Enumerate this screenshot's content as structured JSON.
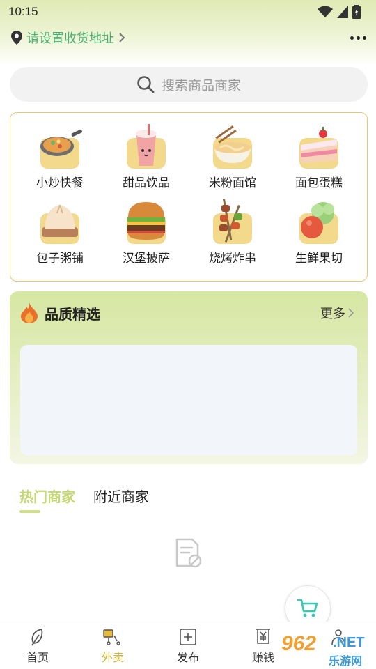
{
  "status_bar": {
    "time": "10:15",
    "icons": [
      "wifi-icon",
      "signal-icon",
      "battery-icon"
    ]
  },
  "header": {
    "location_text": "请设置收货地址",
    "location_icon": "location-pin-icon",
    "more_icon": "more-dots-icon"
  },
  "search": {
    "placeholder": "搜索商品商家",
    "icon": "search-icon"
  },
  "categories": [
    {
      "label": "小炒快餐",
      "icon": "stir-fry-pan-icon"
    },
    {
      "label": "甜品饮品",
      "icon": "milk-tea-cup-icon"
    },
    {
      "label": "米粉面馆",
      "icon": "noodle-bowl-icon"
    },
    {
      "label": "面包蛋糕",
      "icon": "cake-slice-icon"
    },
    {
      "label": "包子粥铺",
      "icon": "steamed-bun-icon"
    },
    {
      "label": "汉堡披萨",
      "icon": "burger-icon"
    },
    {
      "label": "烧烤炸串",
      "icon": "skewer-icon"
    },
    {
      "label": "生鲜果切",
      "icon": "fresh-produce-icon"
    }
  ],
  "quality": {
    "title": "品质精选",
    "icon": "flame-icon",
    "more_label": "更多"
  },
  "tabs": [
    {
      "label": "热门商家",
      "active": true
    },
    {
      "label": "附近商家",
      "active": false
    }
  ],
  "empty_state_icon": "empty-document-icon",
  "cart_icon": "shopping-cart-icon",
  "bottom_nav": [
    {
      "label": "首页",
      "icon": "home-leaf-icon",
      "active": false
    },
    {
      "label": "外卖",
      "icon": "delivery-icon",
      "active": true
    },
    {
      "label": "发布",
      "icon": "plus-square-icon",
      "active": false
    },
    {
      "label": "赚钱",
      "icon": "yen-icon",
      "active": false
    },
    {
      "label": "",
      "icon": "profile-icon",
      "active": false
    }
  ],
  "watermark": {
    "number": "962",
    "suffix": ".NET",
    "site_name": "乐游网"
  },
  "colors": {
    "accent_green": "#4ab06f",
    "active_tab": "#c6d873",
    "active_nav": "#d2b533",
    "category_border": "#e7c873"
  }
}
